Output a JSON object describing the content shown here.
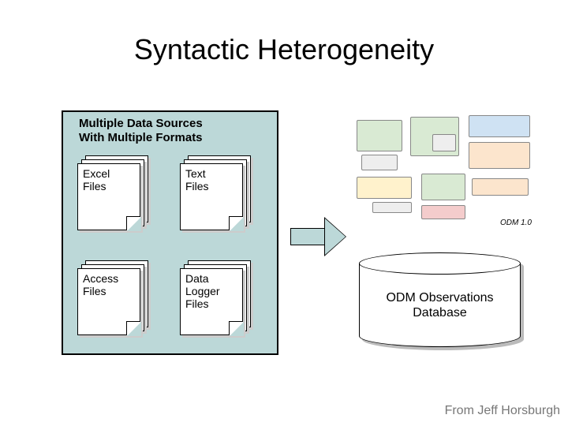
{
  "title": "Syntactic Heterogeneity",
  "sources": {
    "heading": "Multiple Data Sources\nWith Multiple Formats",
    "items": [
      "Excel\nFiles",
      "Text\nFiles",
      "Access\nFiles",
      "Data\nLogger\nFiles"
    ]
  },
  "schema_version": "ODM 1.0",
  "database_label": "ODM Observations\nDatabase",
  "attribution": "From Jeff Horsburgh"
}
